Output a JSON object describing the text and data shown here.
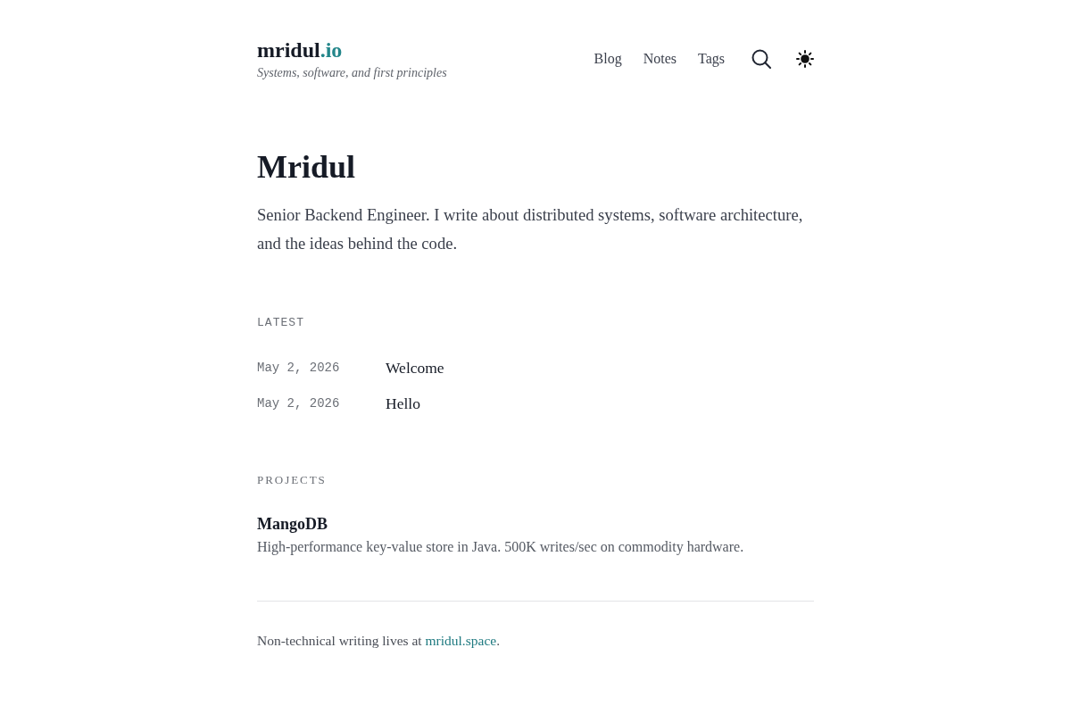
{
  "header": {
    "logo": {
      "name": "mridul",
      "suffix": ".io"
    },
    "tagline": "Systems, software, and first principles",
    "nav": [
      "Blog",
      "Notes",
      "Tags"
    ]
  },
  "intro": {
    "title": "Mridul",
    "bio": "Senior Backend Engineer. I write about distributed systems, software architecture, and the ideas behind the code."
  },
  "latest": {
    "heading": "LATEST",
    "posts": [
      {
        "date": "May 2, 2026",
        "title": "Welcome"
      },
      {
        "date": "May 2, 2026",
        "title": "Hello"
      }
    ]
  },
  "projects": {
    "heading": "PROJECTS",
    "items": [
      {
        "name": "MangoDB",
        "description": "High-performance key-value store in Java. 500K writes/sec on commodity hardware."
      }
    ]
  },
  "footer": {
    "text": "Non-technical writing lives at",
    "link": "mridul.space",
    "end": "."
  }
}
